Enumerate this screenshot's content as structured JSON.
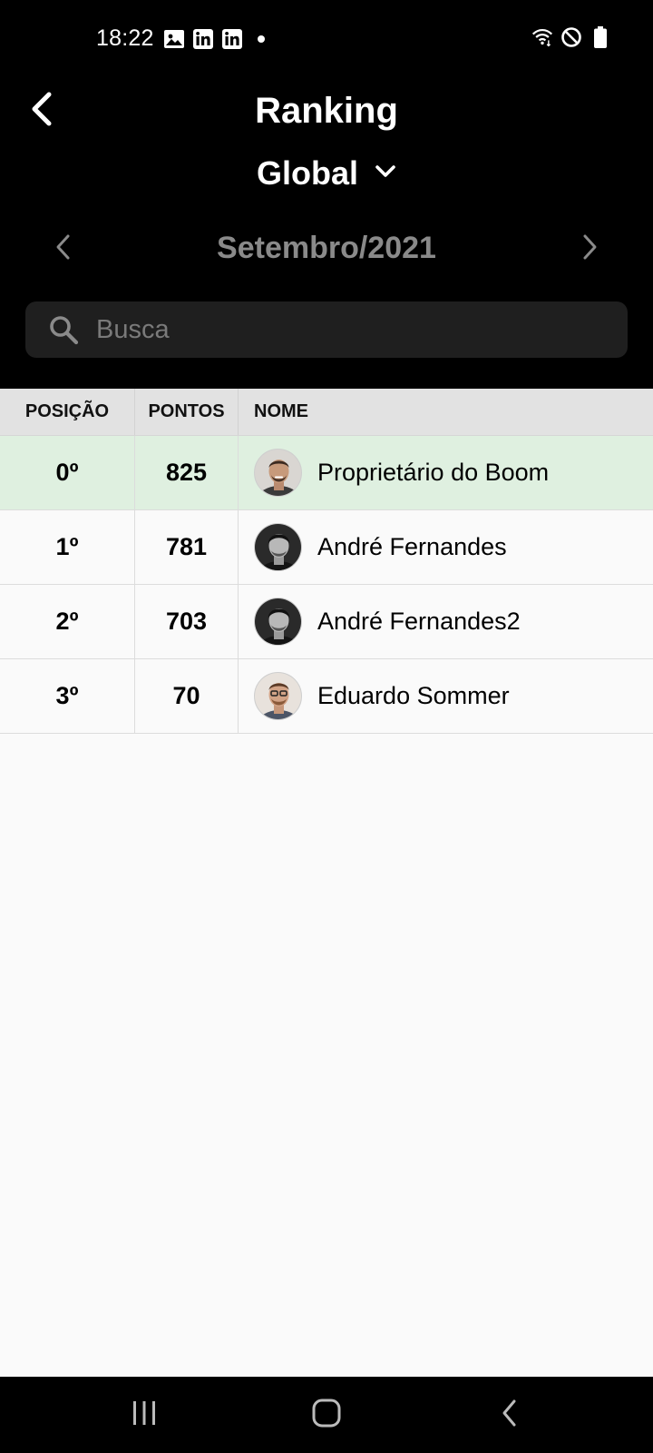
{
  "status_bar": {
    "time": "18:22",
    "notification_icons": [
      "image-icon",
      "linkedin-icon",
      "linkedin-icon",
      "dot-icon"
    ],
    "system_icons": [
      "wifi-icon",
      "do-not-disturb-icon",
      "battery-icon"
    ]
  },
  "header": {
    "title": "Ranking",
    "scope": "Global",
    "month": "Setembro/2021"
  },
  "search": {
    "placeholder": "Busca",
    "value": ""
  },
  "table": {
    "columns": [
      "POSIÇÃO",
      "PONTOS",
      "NOME"
    ],
    "rows": [
      {
        "position": "0º",
        "points": "825",
        "name": "Proprietário do Boom",
        "highlighted": true
      },
      {
        "position": "1º",
        "points": "781",
        "name": "André Fernandes",
        "highlighted": false
      },
      {
        "position": "2º",
        "points": "703",
        "name": "André Fernandes2",
        "highlighted": false
      },
      {
        "position": "3º",
        "points": "70",
        "name": "Eduardo Sommer",
        "highlighted": false
      }
    ]
  },
  "colors": {
    "header_bg": "#000000",
    "highlight_row": "#dff0e0",
    "table_header_bg": "#e2e2e2",
    "month_text": "#8a8a8a"
  }
}
